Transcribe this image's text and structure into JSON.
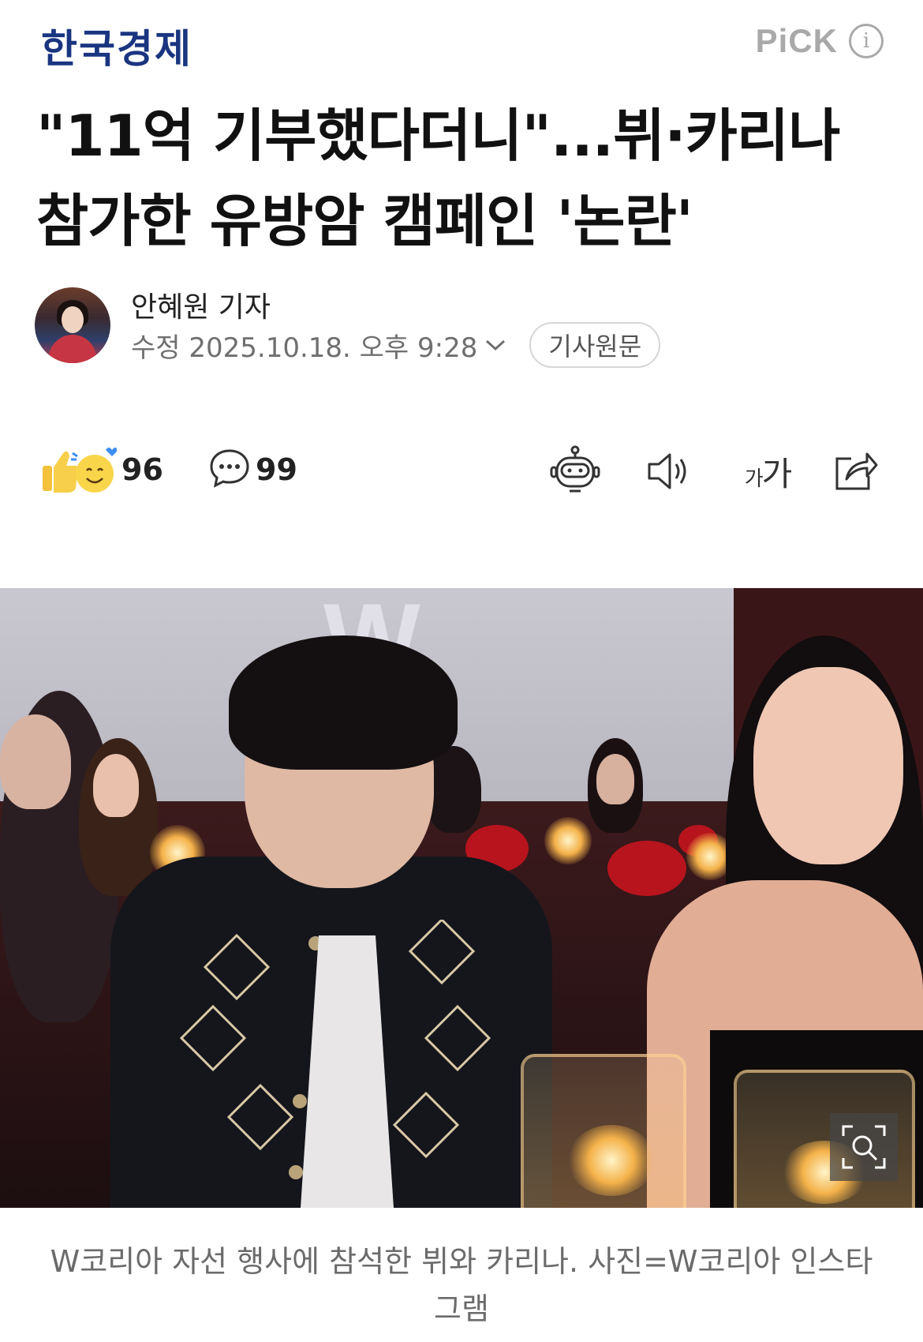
{
  "header": {
    "press_name": "한국경제",
    "pick_label": "PiCK",
    "info_symbol": "i"
  },
  "article": {
    "headline_line1": "\"11억 기부했다더니\"...뷔·카리나",
    "headline_line2": "참가한 유방암 캠페인 '논란'"
  },
  "byline": {
    "reporter": "안혜원 기자",
    "date": "수정 2025.10.18. 오후 9:28",
    "original_button": "기사원문"
  },
  "reactions": {
    "like_count": "96",
    "comment_count": "99"
  },
  "toolbar": {
    "font_size_small": "가",
    "font_size_large": "가",
    "icons": [
      "robot-summary-icon",
      "speaker-icon",
      "font-size-icon",
      "share-icon"
    ]
  },
  "photo": {
    "caption": "W코리아 자선 행사에 참석한 뷔와 카리나. 사진=W코리아 인스타그램",
    "wall_letter": "W"
  },
  "colors": {
    "press_logo": "#1a3580",
    "pick_gray": "#a9a9a9",
    "caption_gray": "#6b6b6b"
  }
}
